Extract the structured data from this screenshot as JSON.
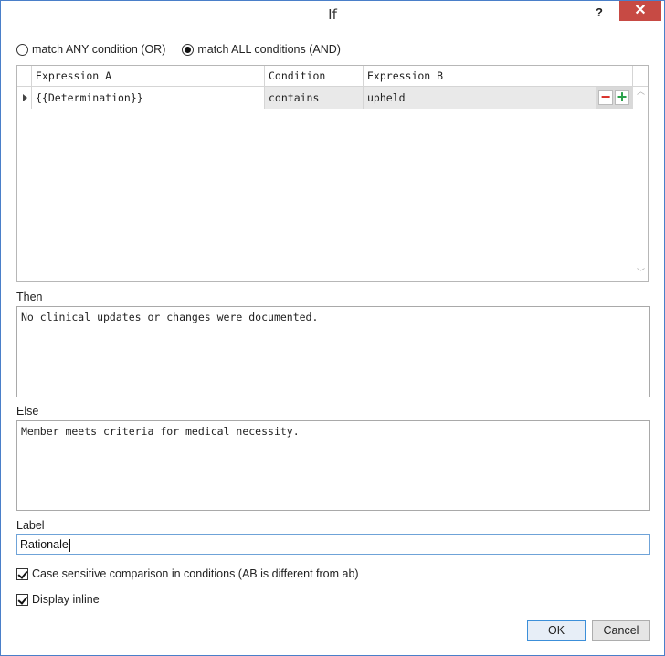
{
  "window": {
    "title": "If",
    "help_label": "?",
    "close_label": "✕"
  },
  "match": {
    "options": [
      {
        "label": "match ANY condition (OR)",
        "checked": false
      },
      {
        "label": "match ALL conditions (AND)",
        "checked": true
      }
    ]
  },
  "grid": {
    "columns": [
      "Expression A",
      "Condition",
      "Expression B"
    ],
    "rows": [
      {
        "expression_a": "{{Determination}}",
        "condition": "contains",
        "expression_b": "upheld"
      }
    ],
    "remove_label": "−",
    "add_label": "+"
  },
  "then": {
    "label": "Then",
    "value": "No clinical updates or changes were documented."
  },
  "else": {
    "label": "Else",
    "value": "Member meets criteria for medical necessity."
  },
  "label_field": {
    "label": "Label",
    "value": "Rationale"
  },
  "options": {
    "case_sensitive": {
      "label": "Case sensitive comparison in conditions (AB is different from ab)",
      "checked": true
    },
    "display_inline": {
      "label": "Display inline",
      "checked": true
    }
  },
  "buttons": {
    "ok": "OK",
    "cancel": "Cancel"
  },
  "colors": {
    "close": "#c74a44",
    "border": "#4a7fc9",
    "remove": "#d9322b",
    "add": "#2ba14b"
  }
}
